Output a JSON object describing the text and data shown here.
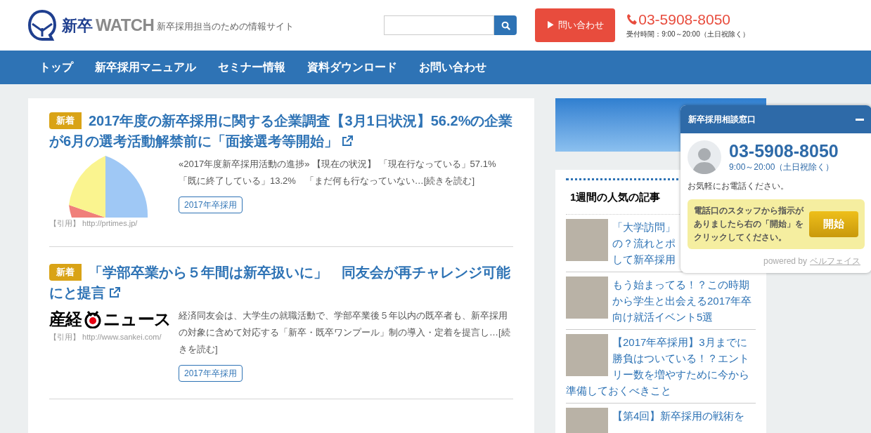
{
  "header": {
    "logo_text": "新卒",
    "logo_text_2": "WATCH",
    "tagline": "新卒採用担当のための情報サイト",
    "contact_button": "▶ 問い合わせ",
    "phone": "03-5908-8050",
    "hours": "受付時間：9:00～20:00（土日祝除く）"
  },
  "nav": {
    "items": [
      {
        "label": "トップ"
      },
      {
        "label": "新卒採用マニュアル"
      },
      {
        "label": "セミナー情報"
      },
      {
        "label": "資料ダウンロード"
      },
      {
        "label": "お問い合わせ"
      }
    ]
  },
  "articles": [
    {
      "badge": "新着",
      "title": "2017年度の新卒採用に関する企業調査【3月1日状況】56.2%の企業が6月の選考活動解禁前に「面接選考等開始」",
      "kind": "pie",
      "source": "【引用】 http://prtimes.jp/",
      "excerpt": "«2017年度新卒採用活動の進捗» 【現在の状況】 「現在行なっている」57.1%　「既に終了している」13.2%　「まだ何も行なっていない…[続きを読む]",
      "tag": "2017年卒採用"
    },
    {
      "badge": "新着",
      "title": "「学部卒業から５年間は新卒扱いに」　同友会が再チャレンジ可能にと提言",
      "kind": "logo",
      "logo_text": "産経",
      "logo_text_2": "ニュース",
      "source": "【引用】 http://www.sankei.com/",
      "excerpt": "経済同友会は、大学生の就職活動で、学部卒業後５年以内の既卒者も、新卒採用の対象に含めて対応する「新卒・既卒ワンプール」制の導入・定着を提言し…[続きを読む]",
      "tag": "2017年卒採用"
    }
  ],
  "sidebar": {
    "popular": {
      "title": "1週間の人気の記事",
      "items": [
        {
          "title_lines": [
            "「大学訪問」",
            "の？流れとポ",
            "して新卒採用"
          ]
        },
        {
          "title": "もう始まってる！？この時期から学生と出会える2017年卒向け就活イベント5選"
        },
        {
          "title": "【2017年卒採用】3月までに勝負はついている！？エントリー数を増やすために今から準備しておくべきこと"
        },
        {
          "title": "【第4回】新卒採用の戦術を"
        }
      ]
    }
  },
  "chat_widget": {
    "title": "新卒採用相談窓口",
    "phone": "03-5908-8050",
    "hours": "9:00～20:00（土日祝除く）",
    "message": "お気軽にお電話ください。",
    "instruction": "電話口のスタッフから指示がありましたら右の「開始」をクリックしてください。",
    "start_button": "開始",
    "powered_by": "powered by",
    "provider": "ベルフェイス"
  }
}
